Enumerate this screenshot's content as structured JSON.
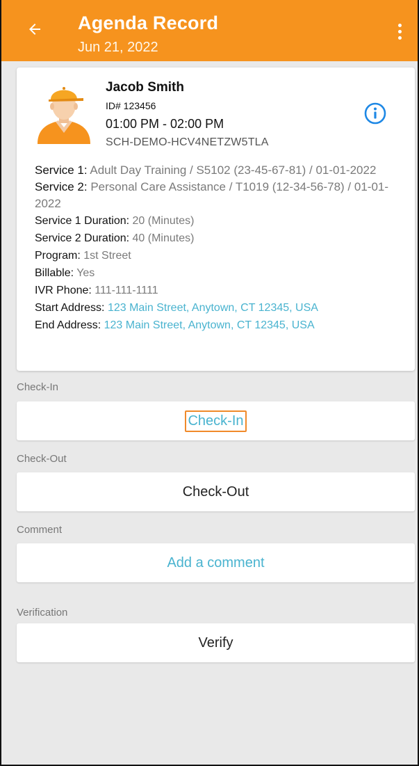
{
  "appbar": {
    "title": "Agenda Record",
    "date": "Jun 21, 2022",
    "color": "#f6931e"
  },
  "client": {
    "name": "Jacob Smith",
    "id": "ID# 123456",
    "time": "01:00 PM - 02:00 PM",
    "schedule_code": "SCH-DEMO-HCV4NETZW5TLA"
  },
  "details": {
    "service1_label": "Service 1:",
    "service1_value": "Adult Day Training / S5102 (23-45-67-81) / 01-01-2022",
    "service2_label": "Service 2:",
    "service2_value": "Personal Care Assistance / T1019 (12-34-56-78) / 01-01-2022",
    "service1_duration_label": "Service 1 Duration:",
    "service1_duration_value": "20 (Minutes)",
    "service2_duration_label": "Service 2 Duration:",
    "service2_duration_value": "40 (Minutes)",
    "program_label": "Program:",
    "program_value": "1st Street",
    "billable_label": "Billable:",
    "billable_value": "Yes",
    "ivr_label": "IVR Phone:",
    "ivr_value": "111-111-1111",
    "start_address_label": "Start Address:",
    "start_address_value": "123 Main Street, Anytown, CT 12345, USA",
    "end_address_label": "End Address:",
    "end_address_value": "123 Main Street, Anytown, CT 12345, USA"
  },
  "sections": {
    "checkin_label": "Check-In",
    "checkin_button": "Check-In",
    "checkout_label": "Check-Out",
    "checkout_button": "Check-Out",
    "comment_label": "Comment",
    "comment_button": "Add a comment",
    "verification_label": "Verification",
    "verify_button": "Verify"
  },
  "icons": {
    "back": "arrow-left-icon",
    "overflow": "more-vertical-icon",
    "info": "info-circle-icon",
    "avatar": "worker-avatar-icon"
  },
  "colors": {
    "accent": "#f6931e",
    "link": "#49b3cf",
    "highlight_border": "#f08a2a"
  }
}
